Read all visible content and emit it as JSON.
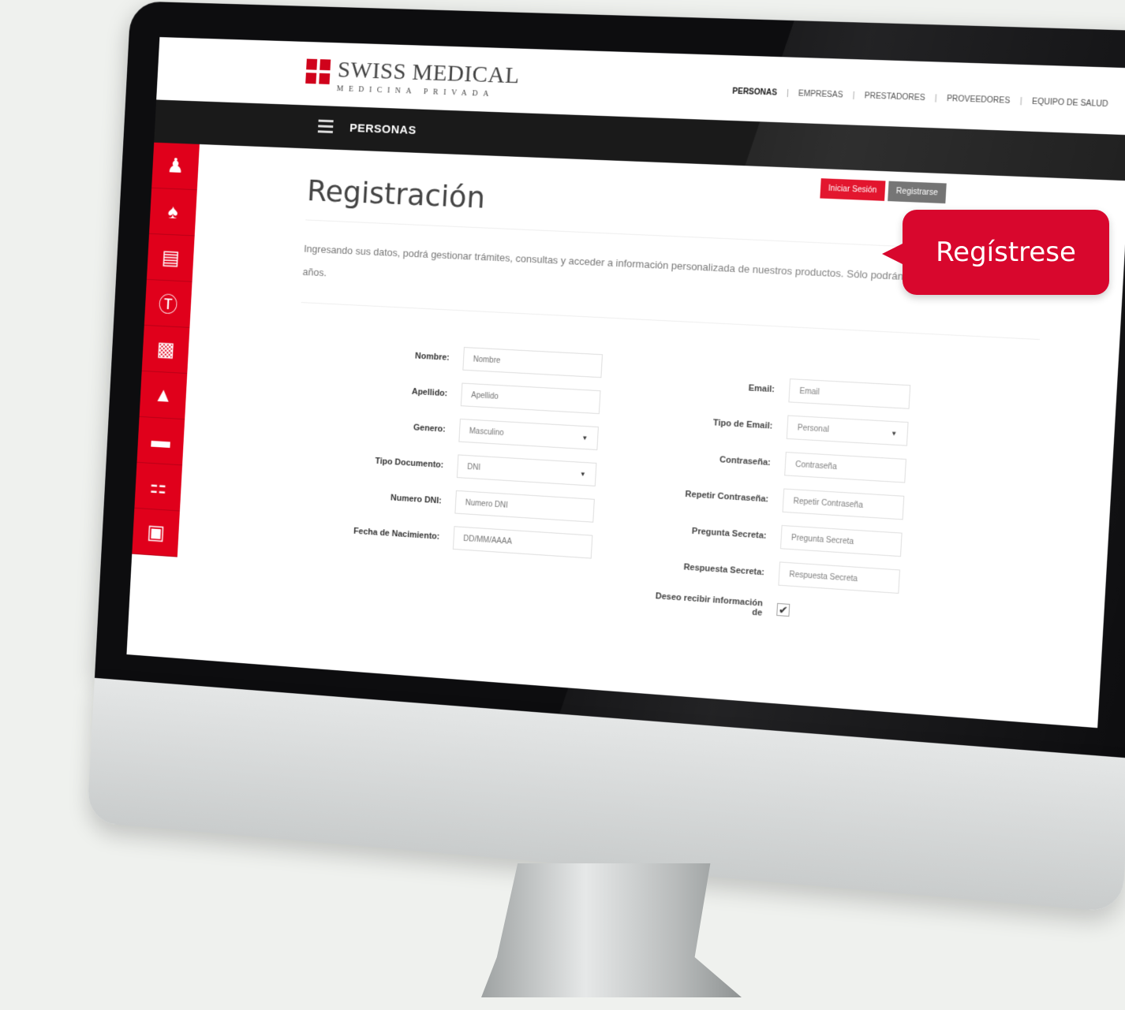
{
  "brand": {
    "name": "SWISS MEDICAL",
    "subtitle": "MEDICINA PRIVADA"
  },
  "nav": {
    "section_title": "PERSONAS",
    "top_links": [
      "PERSONAS",
      "EMPRESAS",
      "PRESTADORES",
      "PROVEEDORES",
      "EQUIPO DE SALUD"
    ]
  },
  "session": {
    "login_label": "Iniciar Sesión",
    "register_label": "Registrarse"
  },
  "sidebar": {
    "icons": [
      "user-icon",
      "group-icon",
      "document-icon",
      "dollar-icon",
      "card-clock-icon",
      "flask-icon",
      "id-card-icon",
      "cart-icon",
      "calendar-icon"
    ]
  },
  "page": {
    "title": "Registración",
    "description": "Ingresando sus datos, podrá gestionar trámites, consultas y acceder a información personalizada de nuestros productos. Sólo podrán registrarse mayores de 18 años."
  },
  "form": {
    "left": [
      {
        "label": "Nombre:",
        "placeholder": "Nombre",
        "type": "text"
      },
      {
        "label": "Apellido:",
        "placeholder": "Apellido",
        "type": "text"
      },
      {
        "label": "Genero:",
        "value": "Masculino",
        "type": "select"
      },
      {
        "label": "Tipo Documento:",
        "value": "DNI",
        "type": "select"
      },
      {
        "label": "Numero DNI:",
        "placeholder": "Numero DNI",
        "type": "text"
      },
      {
        "label": "Fecha de Nacimiento:",
        "placeholder": "DD/MM/AAAA",
        "type": "text"
      }
    ],
    "right": [
      {
        "label": "Email:",
        "placeholder": "Email",
        "type": "text"
      },
      {
        "label": "Tipo de Email:",
        "value": "Personal",
        "type": "select"
      },
      {
        "label": "Contraseña:",
        "placeholder": "Contraseña",
        "type": "text"
      },
      {
        "label": "Repetir Contraseña:",
        "placeholder": "Repetir Contraseña",
        "type": "text"
      },
      {
        "label": "Pregunta Secreta:",
        "placeholder": "Pregunta Secreta",
        "type": "text"
      },
      {
        "label": "Respuesta Secreta:",
        "placeholder": "Respuesta Secreta",
        "type": "text"
      }
    ],
    "newsletter_label": "Deseo recibir información de",
    "newsletter_checked": true
  },
  "callout": {
    "text": "Regístrese"
  },
  "colors": {
    "brand_red": "#e0001b",
    "nav_dark": "#1a1a1a",
    "callout_red": "#d8072d"
  }
}
